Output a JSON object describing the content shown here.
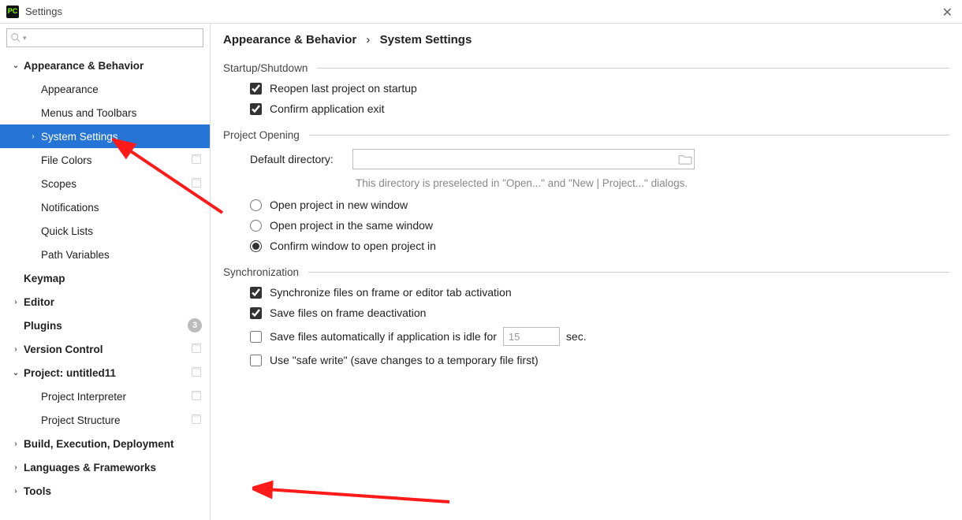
{
  "title": "Settings",
  "breadcrumb": {
    "part1": "Appearance & Behavior",
    "sep": "›",
    "part2": "System Settings"
  },
  "search": {
    "placeholder": ""
  },
  "sidebar": {
    "items": [
      {
        "label": "Appearance & Behavior",
        "level": 0,
        "bold": true,
        "arrow": "expanded"
      },
      {
        "label": "Appearance",
        "level": 1
      },
      {
        "label": "Menus and Toolbars",
        "level": 1
      },
      {
        "label": "System Settings",
        "level": 1,
        "selected": true,
        "arrow": "collapsed"
      },
      {
        "label": "File Colors",
        "level": 1,
        "rightIcon": true
      },
      {
        "label": "Scopes",
        "level": 1,
        "rightIcon": true
      },
      {
        "label": "Notifications",
        "level": 1
      },
      {
        "label": "Quick Lists",
        "level": 1
      },
      {
        "label": "Path Variables",
        "level": 1
      },
      {
        "label": "Keymap",
        "level": 0,
        "bold": true
      },
      {
        "label": "Editor",
        "level": 0,
        "bold": true,
        "arrow": "collapsed"
      },
      {
        "label": "Plugins",
        "level": 0,
        "bold": true,
        "badge": "3"
      },
      {
        "label": "Version Control",
        "level": 0,
        "bold": true,
        "arrow": "collapsed",
        "rightIcon": true
      },
      {
        "label": "Project: untitled11",
        "level": 0,
        "bold": true,
        "arrow": "expanded",
        "rightIcon": true
      },
      {
        "label": "Project Interpreter",
        "level": 1,
        "rightIcon": true
      },
      {
        "label": "Project Structure",
        "level": 1,
        "rightIcon": true
      },
      {
        "label": "Build, Execution, Deployment",
        "level": 0,
        "bold": true,
        "arrow": "collapsed"
      },
      {
        "label": "Languages & Frameworks",
        "level": 0,
        "bold": true,
        "arrow": "collapsed"
      },
      {
        "label": "Tools",
        "level": 0,
        "bold": true,
        "arrow": "collapsed"
      }
    ]
  },
  "sections": {
    "startup": {
      "title": "Startup/Shutdown",
      "reopen": {
        "label": "Reopen last project on startup",
        "checked": true
      },
      "confirm_exit": {
        "label": "Confirm application exit",
        "checked": true
      }
    },
    "project_opening": {
      "title": "Project Opening",
      "default_dir_label": "Default directory:",
      "default_dir_value": "",
      "hint": "This directory is preselected in \"Open...\" and \"New | Project...\" dialogs.",
      "radio_new": "Open project in new window",
      "radio_same": "Open project in the same window",
      "radio_confirm": "Confirm window to open project in",
      "radio_selected": "confirm"
    },
    "sync": {
      "title": "Synchronization",
      "sync_files": {
        "label": "Synchronize files on frame or editor tab activation",
        "checked": true
      },
      "save_deact": {
        "label": "Save files on frame deactivation",
        "checked": true
      },
      "save_idle": {
        "label_before": "Save files automatically if application is idle for",
        "value": "15",
        "label_after": "sec.",
        "checked": false
      },
      "safe_write": {
        "label": "Use \"safe write\" (save changes to a temporary file first)",
        "checked": false
      }
    }
  }
}
